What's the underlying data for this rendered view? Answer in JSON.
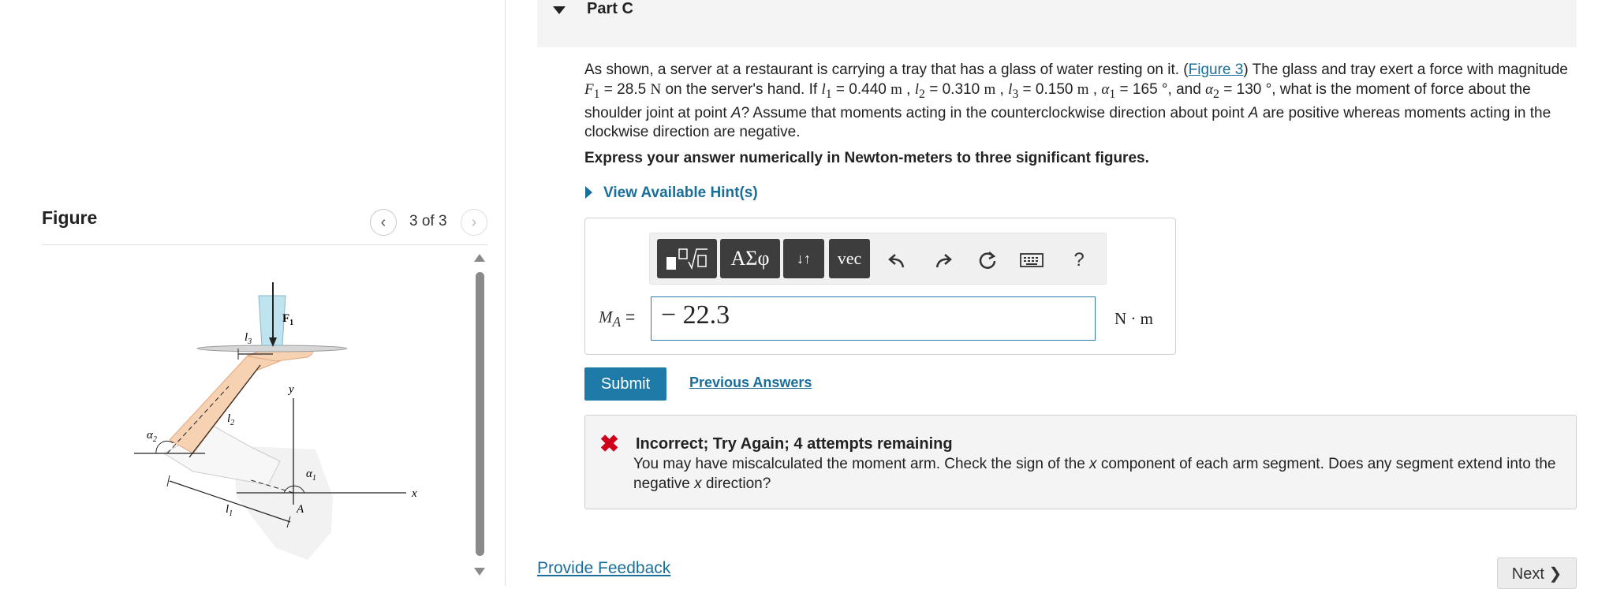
{
  "figure_panel": {
    "heading": "Figure",
    "counter": "3 of 3",
    "prev_icon": "chevron-left-icon",
    "next_icon": "chevron-right-icon",
    "labels": {
      "F1": "F",
      "F1_sub": "1",
      "l1": "l",
      "l1_sub": "1",
      "l2": "l",
      "l2_sub": "2",
      "l3": "l",
      "l3_sub": "3",
      "alpha1": "α",
      "alpha1_sub": "1",
      "alpha2": "α",
      "alpha2_sub": "2",
      "A": "A",
      "x": "x",
      "y": "y"
    }
  },
  "part": {
    "title": "Part C"
  },
  "question": {
    "t1": "As shown, a server at a restaurant is carrying a tray that has a glass of water resting on it. (",
    "link": "Figure 3",
    "t2": ") The glass and tray exert a force with magnitude ",
    "F1": "F",
    "F1_sub": "1",
    "F1_val": " = 28.5 ",
    "F1_unit": "N",
    "t3": " on the server's hand. If ",
    "l1": "l",
    "l1_sub": "1",
    "l1_val": " = 0.440 ",
    "l1_unit": "m",
    "sep1": " , ",
    "l2": "l",
    "l2_sub": "2",
    "l2_val": " = 0.310 ",
    "l2_unit": "m",
    "sep2": " , ",
    "l3": "l",
    "l3_sub": "3",
    "l3_val": " = 0.150 ",
    "l3_unit": "m",
    "sep3": " , ",
    "a1": "α",
    "a1_sub": "1",
    "a1_val": " = 165 °",
    "t4": ", and ",
    "a2": "α",
    "a2_sub": "2",
    "a2_val": " = 130 °",
    "t5": ", what is the moment of force about the shoulder joint at point ",
    "pointA": "A",
    "t6": "? Assume that moments acting in the counterclockwise direction about point ",
    "pointA2": "A",
    "t7": " are positive whereas moments acting in the clockwise direction are negative."
  },
  "instruction": "Express your answer numerically in Newton-meters to three significant figures.",
  "hint_link": "View Available Hint(s)",
  "toolbar": {
    "symbols": "ΑΣφ",
    "subscript": "↓↑",
    "vec": "vec",
    "undo_icon": "undo-icon",
    "redo_icon": "redo-icon",
    "reset_icon": "reset-icon",
    "keyboard_icon": "keyboard-icon",
    "help": "?"
  },
  "answer": {
    "label_var": "M",
    "label_sub": "A",
    "label_eq": " =",
    "value": "− 22.3",
    "unit": "N · m"
  },
  "submit": "Submit",
  "previous_answers": "Previous Answers",
  "feedback": {
    "icon": "x-icon",
    "title": "Incorrect; Try Again; 4 attempts remaining",
    "t1": "You may have miscalculated the moment arm. Check the sign of the ",
    "x1": "x",
    "t2": " component of each arm segment. Does any segment extend into the negative ",
    "x2": "x",
    "t3": " direction?"
  },
  "provide_feedback": "Provide Feedback",
  "next": "Next ❯"
}
